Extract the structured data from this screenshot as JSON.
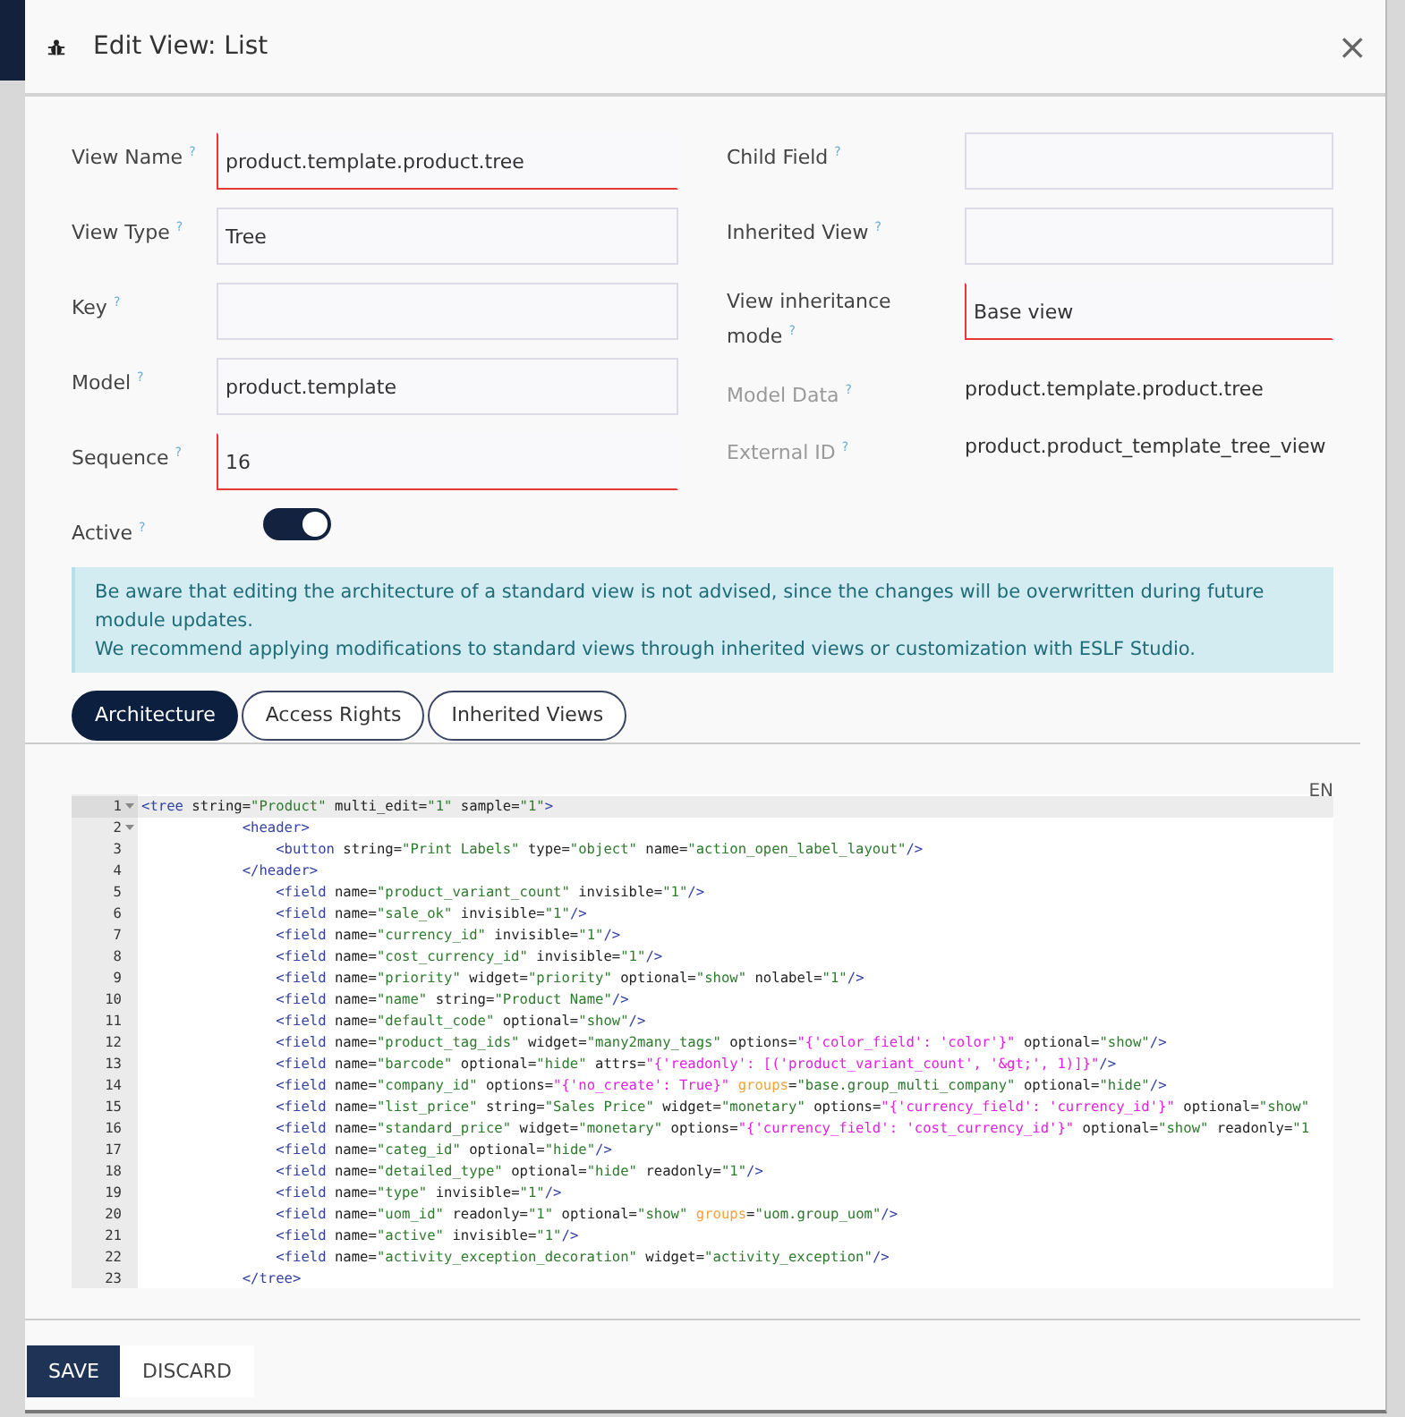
{
  "dialog": {
    "title": "Edit View: List",
    "close": "×"
  },
  "form": {
    "left": [
      {
        "kind": "input",
        "label": "View Name",
        "help": "?",
        "value": "product.template.product.tree",
        "required": true
      },
      {
        "kind": "input",
        "label": "View Type",
        "help": "?",
        "value": "Tree",
        "required": false
      },
      {
        "kind": "input",
        "label": "Key",
        "help": "?",
        "required": false
      },
      {
        "kind": "input",
        "label": "Model",
        "help": "?",
        "value": "product.template",
        "required": false
      },
      {
        "kind": "input",
        "label": "Sequence",
        "help": "?",
        "value": "16",
        "required": true
      },
      {
        "kind": "toggle",
        "label": "Active",
        "help": "?",
        "on": true
      }
    ],
    "right": [
      {
        "kind": "input",
        "label": "Child Field",
        "help": "?",
        "required": false
      },
      {
        "kind": "input",
        "label": "Inherited View",
        "help": "?",
        "required": false
      },
      {
        "kind": "input",
        "label": "View inheritance mode",
        "help": "?",
        "value": "Base view",
        "required": true
      },
      {
        "kind": "readonly",
        "label": "Model Data",
        "help": "?",
        "value": "product.template.product.tree"
      },
      {
        "kind": "readonly",
        "label": "External ID",
        "help": "?",
        "value": "product.product_template_tree_view"
      }
    ]
  },
  "alert": [
    "Be aware that editing the architecture of a standard view is not advised, since the changes will be overwritten during future module updates.",
    "We recommend applying modifications to standard views through inherited views or customization with ESLF Studio."
  ],
  "tabs": [
    {
      "label": "Architecture",
      "selected": true
    },
    {
      "label": "Access Rights",
      "selected": false
    },
    {
      "label": "Inherited Views",
      "selected": false
    }
  ],
  "editor": {
    "language": "EN",
    "lines": [
      {
        "number": "1",
        "expanded": true,
        "tokens": [
          {
            "kind": "tag",
            "text": "<tree"
          },
          {
            "kind": "plain",
            "text": " string="
          },
          {
            "kind": "string",
            "text": "\"Product\""
          },
          {
            "kind": "plain",
            "text": " multi_edit="
          },
          {
            "kind": "string",
            "text": "\"1\""
          },
          {
            "kind": "plain",
            "text": " sample="
          },
          {
            "kind": "string",
            "text": "\"1\""
          },
          {
            "kind": "tag",
            "text": ">"
          }
        ]
      },
      {
        "number": "2",
        "expanded": true,
        "tokens": [
          {
            "kind": "tag",
            "text": "            <header>"
          }
        ]
      },
      {
        "number": "3",
        "tokens": [
          {
            "kind": "tag",
            "text": "                <button"
          },
          {
            "kind": "plain",
            "text": " string="
          },
          {
            "kind": "string",
            "text": "\"Print Labels\""
          },
          {
            "kind": "plain",
            "text": " type="
          },
          {
            "kind": "string",
            "text": "\"object\""
          },
          {
            "kind": "plain",
            "text": " name="
          },
          {
            "kind": "string",
            "text": "\"action_open_label_layout\""
          },
          {
            "kind": "tag",
            "text": "/>"
          }
        ]
      },
      {
        "number": "4",
        "tokens": [
          {
            "kind": "tag",
            "text": "            </header>"
          }
        ]
      },
      {
        "number": "5",
        "tokens": [
          {
            "kind": "tag",
            "text": "                <field"
          },
          {
            "kind": "plain",
            "text": " name="
          },
          {
            "kind": "string",
            "text": "\"product_variant_count\""
          },
          {
            "kind": "plain",
            "text": " invisible="
          },
          {
            "kind": "string",
            "text": "\"1\""
          },
          {
            "kind": "tag",
            "text": "/>"
          }
        ]
      },
      {
        "number": "6",
        "tokens": [
          {
            "kind": "tag",
            "text": "                <field"
          },
          {
            "kind": "plain",
            "text": " name="
          },
          {
            "kind": "string",
            "text": "\"sale_ok\""
          },
          {
            "kind": "plain",
            "text": " invisible="
          },
          {
            "kind": "string",
            "text": "\"1\""
          },
          {
            "kind": "tag",
            "text": "/>"
          }
        ]
      },
      {
        "number": "7",
        "tokens": [
          {
            "kind": "tag",
            "text": "                <field"
          },
          {
            "kind": "plain",
            "text": " name="
          },
          {
            "kind": "string",
            "text": "\"currency_id\""
          },
          {
            "kind": "plain",
            "text": " invisible="
          },
          {
            "kind": "string",
            "text": "\"1\""
          },
          {
            "kind": "tag",
            "text": "/>"
          }
        ]
      },
      {
        "number": "8",
        "tokens": [
          {
            "kind": "tag",
            "text": "                <field"
          },
          {
            "kind": "plain",
            "text": " name="
          },
          {
            "kind": "string",
            "text": "\"cost_currency_id\""
          },
          {
            "kind": "plain",
            "text": " invisible="
          },
          {
            "kind": "string",
            "text": "\"1\""
          },
          {
            "kind": "tag",
            "text": "/>"
          }
        ]
      },
      {
        "number": "9",
        "tokens": [
          {
            "kind": "tag",
            "text": "                <field"
          },
          {
            "kind": "plain",
            "text": " name="
          },
          {
            "kind": "string",
            "text": "\"priority\""
          },
          {
            "kind": "plain",
            "text": " widget="
          },
          {
            "kind": "string",
            "text": "\"priority\""
          },
          {
            "kind": "plain",
            "text": " optional="
          },
          {
            "kind": "string",
            "text": "\"show\""
          },
          {
            "kind": "plain",
            "text": " nolabel="
          },
          {
            "kind": "string",
            "text": "\"1\""
          },
          {
            "kind": "tag",
            "text": "/>"
          }
        ]
      },
      {
        "number": "10",
        "tokens": [
          {
            "kind": "tag",
            "text": "                <field"
          },
          {
            "kind": "plain",
            "text": " name="
          },
          {
            "kind": "string",
            "text": "\"name\""
          },
          {
            "kind": "plain",
            "text": " string="
          },
          {
            "kind": "string",
            "text": "\"Product Name\""
          },
          {
            "kind": "tag",
            "text": "/>"
          }
        ]
      },
      {
        "number": "11",
        "tokens": [
          {
            "kind": "tag",
            "text": "                <field"
          },
          {
            "kind": "plain",
            "text": " name="
          },
          {
            "kind": "string",
            "text": "\"default_code\""
          },
          {
            "kind": "plain",
            "text": " optional="
          },
          {
            "kind": "string",
            "text": "\"show\""
          },
          {
            "kind": "tag",
            "text": "/>"
          }
        ]
      },
      {
        "number": "12",
        "tokens": [
          {
            "kind": "tag",
            "text": "                <field"
          },
          {
            "kind": "plain",
            "text": " name="
          },
          {
            "kind": "string",
            "text": "\"product_tag_ids\""
          },
          {
            "kind": "plain",
            "text": " widget="
          },
          {
            "kind": "string",
            "text": "\"many2many_tags\""
          },
          {
            "kind": "plain",
            "text": " options="
          },
          {
            "kind": "dict",
            "text": "\"{'color_field': 'color'}\""
          },
          {
            "kind": "plain",
            "text": " optional="
          },
          {
            "kind": "string",
            "text": "\"show\""
          },
          {
            "kind": "tag",
            "text": "/>"
          }
        ]
      },
      {
        "number": "13",
        "tokens": [
          {
            "kind": "tag",
            "text": "                <field"
          },
          {
            "kind": "plain",
            "text": " name="
          },
          {
            "kind": "string",
            "text": "\"barcode\""
          },
          {
            "kind": "plain",
            "text": " optional="
          },
          {
            "kind": "string",
            "text": "\"hide\""
          },
          {
            "kind": "plain",
            "text": " attrs="
          },
          {
            "kind": "dict",
            "text": "\"{'readonly': [('product_variant_count', '&gt;', 1)]}\""
          },
          {
            "kind": "tag",
            "text": "/>"
          }
        ]
      },
      {
        "number": "14",
        "tokens": [
          {
            "kind": "tag",
            "text": "                <field"
          },
          {
            "kind": "plain",
            "text": " name="
          },
          {
            "kind": "string",
            "text": "\"company_id\""
          },
          {
            "kind": "plain",
            "text": " options="
          },
          {
            "kind": "dict",
            "text": "\"{'no_create': True}\""
          },
          {
            "kind": "group",
            "text": " groups"
          },
          {
            "kind": "plain",
            "text": "="
          },
          {
            "kind": "string",
            "text": "\"base.group_multi_company\""
          },
          {
            "kind": "plain",
            "text": " optional="
          },
          {
            "kind": "string",
            "text": "\"hide\""
          },
          {
            "kind": "tag",
            "text": "/>"
          }
        ]
      },
      {
        "number": "15",
        "tokens": [
          {
            "kind": "tag",
            "text": "                <field"
          },
          {
            "kind": "plain",
            "text": " name="
          },
          {
            "kind": "string",
            "text": "\"list_price\""
          },
          {
            "kind": "plain",
            "text": " string="
          },
          {
            "kind": "string",
            "text": "\"Sales Price\""
          },
          {
            "kind": "plain",
            "text": " widget="
          },
          {
            "kind": "string",
            "text": "\"monetary\""
          },
          {
            "kind": "plain",
            "text": " options="
          },
          {
            "kind": "dict",
            "text": "\"{'currency_field': 'currency_id'}\""
          },
          {
            "kind": "plain",
            "text": " optional="
          },
          {
            "kind": "string",
            "text": "\"show\""
          }
        ]
      },
      {
        "number": "16",
        "tokens": [
          {
            "kind": "tag",
            "text": "                <field"
          },
          {
            "kind": "plain",
            "text": " name="
          },
          {
            "kind": "string",
            "text": "\"standard_price\""
          },
          {
            "kind": "plain",
            "text": " widget="
          },
          {
            "kind": "string",
            "text": "\"monetary\""
          },
          {
            "kind": "plain",
            "text": " options="
          },
          {
            "kind": "dict",
            "text": "\"{'currency_field': 'cost_currency_id'}\""
          },
          {
            "kind": "plain",
            "text": " optional="
          },
          {
            "kind": "string",
            "text": "\"show\""
          },
          {
            "kind": "plain",
            "text": " readonly="
          },
          {
            "kind": "string",
            "text": "\"1"
          }
        ]
      },
      {
        "number": "17",
        "tokens": [
          {
            "kind": "tag",
            "text": "                <field"
          },
          {
            "kind": "plain",
            "text": " name="
          },
          {
            "kind": "string",
            "text": "\"categ_id\""
          },
          {
            "kind": "plain",
            "text": " optional="
          },
          {
            "kind": "string",
            "text": "\"hide\""
          },
          {
            "kind": "tag",
            "text": "/>"
          }
        ]
      },
      {
        "number": "18",
        "tokens": [
          {
            "kind": "tag",
            "text": "                <field"
          },
          {
            "kind": "plain",
            "text": " name="
          },
          {
            "kind": "string",
            "text": "\"detailed_type\""
          },
          {
            "kind": "plain",
            "text": " optional="
          },
          {
            "kind": "string",
            "text": "\"hide\""
          },
          {
            "kind": "plain",
            "text": " readonly="
          },
          {
            "kind": "string",
            "text": "\"1\""
          },
          {
            "kind": "tag",
            "text": "/>"
          }
        ]
      },
      {
        "number": "19",
        "tokens": [
          {
            "kind": "tag",
            "text": "                <field"
          },
          {
            "kind": "plain",
            "text": " name="
          },
          {
            "kind": "string",
            "text": "\"type\""
          },
          {
            "kind": "plain",
            "text": " invisible="
          },
          {
            "kind": "string",
            "text": "\"1\""
          },
          {
            "kind": "tag",
            "text": "/>"
          }
        ]
      },
      {
        "number": "20",
        "tokens": [
          {
            "kind": "tag",
            "text": "                <field"
          },
          {
            "kind": "plain",
            "text": " name="
          },
          {
            "kind": "string",
            "text": "\"uom_id\""
          },
          {
            "kind": "plain",
            "text": " readonly="
          },
          {
            "kind": "string",
            "text": "\"1\""
          },
          {
            "kind": "plain",
            "text": " optional="
          },
          {
            "kind": "string",
            "text": "\"show\""
          },
          {
            "kind": "group",
            "text": " groups"
          },
          {
            "kind": "plain",
            "text": "="
          },
          {
            "kind": "string",
            "text": "\"uom.group_uom\""
          },
          {
            "kind": "tag",
            "text": "/>"
          }
        ]
      },
      {
        "number": "21",
        "tokens": [
          {
            "kind": "tag",
            "text": "                <field"
          },
          {
            "kind": "plain",
            "text": " name="
          },
          {
            "kind": "string",
            "text": "\"active\""
          },
          {
            "kind": "plain",
            "text": " invisible="
          },
          {
            "kind": "string",
            "text": "\"1\""
          },
          {
            "kind": "tag",
            "text": "/>"
          }
        ]
      },
      {
        "number": "22",
        "tokens": [
          {
            "kind": "tag",
            "text": "                <field"
          },
          {
            "kind": "plain",
            "text": " name="
          },
          {
            "kind": "string",
            "text": "\"activity_exception_decoration\""
          },
          {
            "kind": "plain",
            "text": " widget="
          },
          {
            "kind": "string",
            "text": "\"activity_exception\""
          },
          {
            "kind": "tag",
            "text": "/>"
          }
        ]
      },
      {
        "number": "23",
        "tokens": [
          {
            "kind": "tag",
            "text": "            </tree>"
          }
        ]
      }
    ]
  },
  "buttons": [
    {
      "label": "SAVE",
      "kind": "primary"
    },
    {
      "label": "DISCARD",
      "kind": "secondary"
    }
  ]
}
